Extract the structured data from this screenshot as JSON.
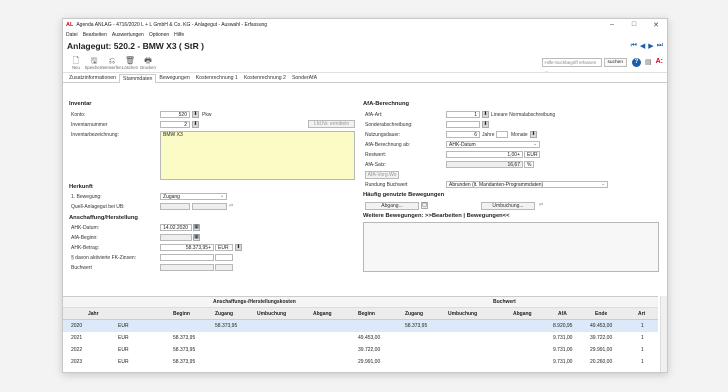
{
  "window": {
    "title": "Agenda ANLAG - 4716/2020 L + L GmbH & Co. KG - Anlagegut - Auswahl - Erfassung",
    "logo": "AL",
    "controls": {
      "minimize": "–",
      "maximize": "□",
      "close": "✕"
    }
  },
  "menu": [
    "Datei",
    "Bearbeiten",
    "Auswertungen",
    "Optionen",
    "Hilfe"
  ],
  "header": {
    "title": "Anlagegut: 520.2 - BMW X3 ( StR )",
    "nav": {
      "first": "⏮",
      "prev": "◀",
      "next": "▶",
      "last": "⏭"
    }
  },
  "toolbar": {
    "buttons": [
      {
        "label": "Neu",
        "icon": "🗋"
      },
      {
        "label": "Speichern",
        "icon": "🖫"
      },
      {
        "label": "Verwerfen",
        "icon": "⎌"
      },
      {
        "label": "Löschen",
        "icon": "🗑"
      },
      {
        "label": "Drucken",
        "icon": "🖶"
      }
    ],
    "search_placeholder": "Hilfe-Suchbegriff erfassen ...",
    "search_button": "suchen"
  },
  "tabs": [
    "Zusatzinformationen",
    "Stammdaten",
    "Bewegungen",
    "Kostenrechnung 1",
    "Kostenrechnung 2",
    "SonderAfA"
  ],
  "active_tab": 1,
  "inventar": {
    "section": "Inventar",
    "konto_label": "Konto:",
    "konto_value": "520",
    "konto_name": "Pkw",
    "invnr_label": "Inventarnummer",
    "invnr_value": "2",
    "invnr_button": "Lfd.Nr. ermitteln",
    "bez_label": "Inventarbezeichnung:",
    "bez_value": "BMW X3"
  },
  "herkunft": {
    "section": "Herkunft",
    "bewegung_label": "1. Bewegung:",
    "bewegung_value": "Zugang",
    "quell_label": "Quell-Anlagegut bei UB:"
  },
  "anschaffung": {
    "section": "Anschaffung/Herstellung",
    "ahk_datum_label": "AHK-Datum:",
    "ahk_datum_value": "14.02.2020",
    "afa_beginn_label": "AfA-Beginn:",
    "ahk_betrag_label": "AHK-Betrag:",
    "ahk_betrag_value": "58.373,95+",
    "currency": "EUR",
    "fk_label": "§  davon aktivierte FK-Zinsen:",
    "buchwert_label": "Buchwert"
  },
  "afa": {
    "section": "AfA-Berechnung",
    "art_label": "AfA-Art:",
    "art_value": "1",
    "art_text": "Lineare Normalabschreibung",
    "sonder_label": "Sonderabschreibung:",
    "nutzung_label": "Nutzungsdauer:",
    "nutzung_value": "6",
    "jahre": "Jahre",
    "monate": "Monate",
    "ab_label": "AfA-Berechnung ab:",
    "ab_value": "AHK-Datum",
    "rest_label": "Restwert:",
    "rest_value": "1,00+",
    "rest_unit": "EUR",
    "satz_label": "AfA-Satz:",
    "satz_value": "16,67",
    "satz_unit": "%",
    "vorg_button": "AfA-Vorg.Wo",
    "rundung_label": "Rundung Buchwert",
    "rundung_value": "Abrunden (lt. Mandanten-Programmdaten)"
  },
  "haeufig": {
    "section": "Häufig genutzte Bewegungen",
    "abgang": "Abgang...",
    "umbuchung": "Umbuchung..."
  },
  "weitere": {
    "section": "Weitere Bewegungen: >>Bearbeiten | Bewegungen<<"
  },
  "table": {
    "group_ahk": "Anschaffungs-/Herstellungskosten",
    "group_bw": "Buchwert",
    "headers": [
      "Jahr",
      "",
      "Beginn",
      "Zugang",
      "Umbuchung",
      "Abgang",
      "Beginn",
      "Zugang",
      "Umbuchung",
      "Abgang",
      "AfA",
      "Ende",
      "Art"
    ],
    "rows": [
      [
        "2020",
        "EUR",
        "",
        "58.373,95",
        "",
        "",
        "",
        "58.373,95",
        "",
        "",
        "8.920,95",
        "49.453,00",
        "1"
      ],
      [
        "2021",
        "EUR",
        "58.373,95",
        "",
        "",
        "",
        "49.453,00",
        "",
        "",
        "",
        "9.731,00",
        "39.722,00",
        "1"
      ],
      [
        "2022",
        "EUR",
        "58.373,95",
        "",
        "",
        "",
        "39.722,00",
        "",
        "",
        "",
        "9.731,00",
        "29.991,00",
        "1"
      ],
      [
        "2023",
        "EUR",
        "58.373,95",
        "",
        "",
        "",
        "29.991,00",
        "",
        "",
        "",
        "9.731,00",
        "20.260,00",
        "1"
      ]
    ]
  }
}
